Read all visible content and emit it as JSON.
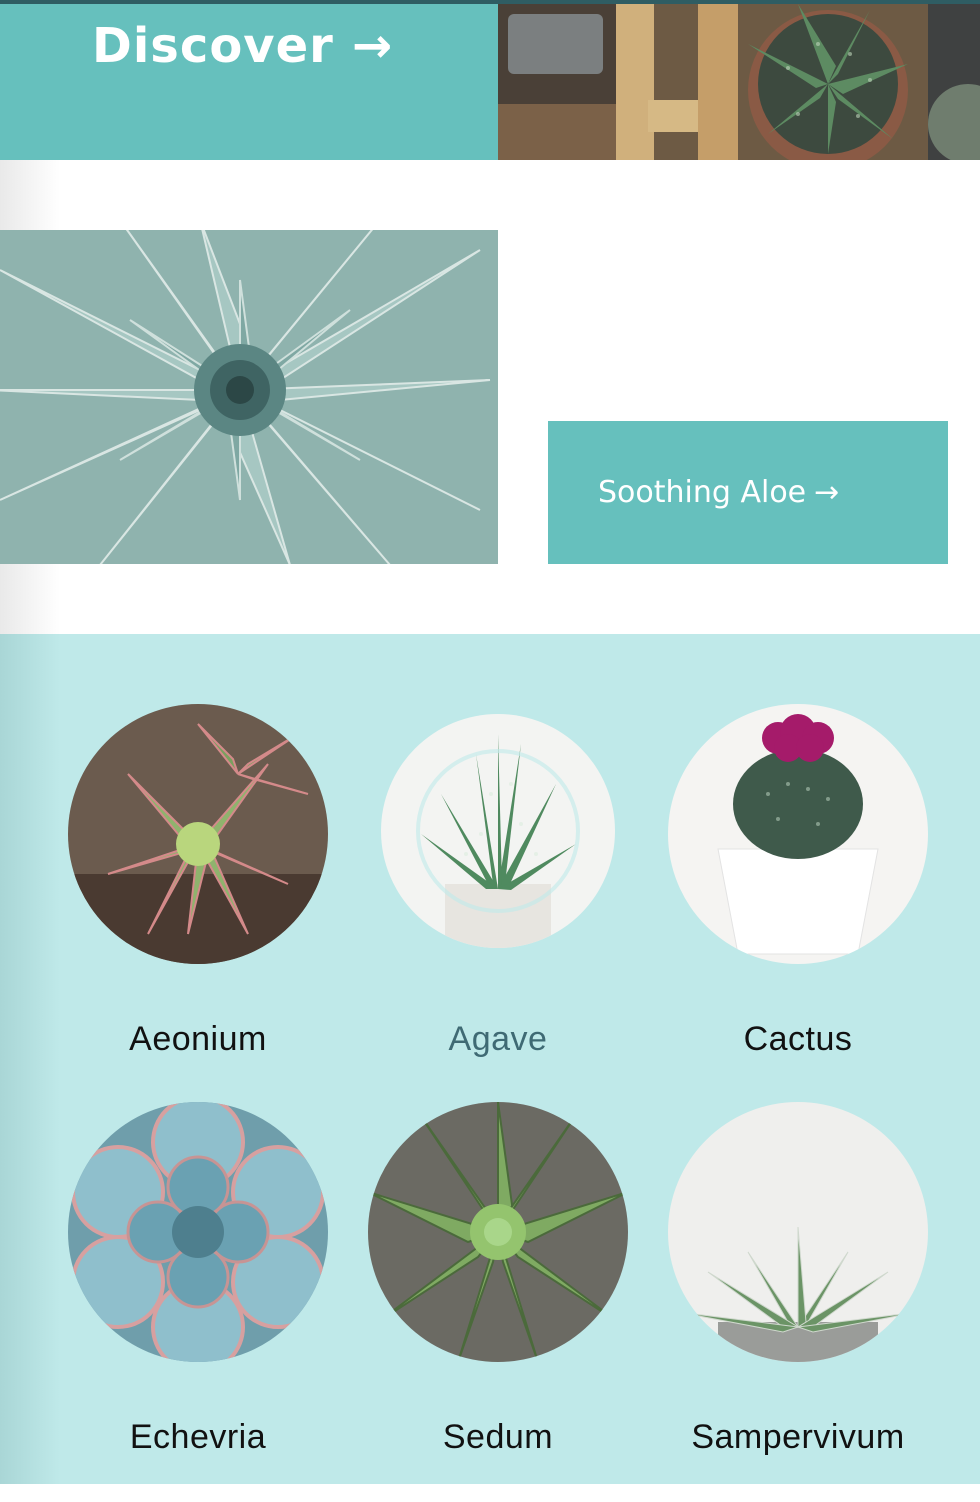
{
  "hero": {
    "discover_label": "Discover",
    "discover_arrow": "→",
    "image_alt": "succulents in pots in a wooden crate",
    "tile_color": "#66c0bd"
  },
  "feature": {
    "image_alt": "agave rosette close-up",
    "cta_label": "Soothing Aloe",
    "cta_arrow": "→"
  },
  "catalog": {
    "background": "#bfe9e9",
    "items": [
      {
        "label": "Aeonium"
      },
      {
        "label": "Agave"
      },
      {
        "label": "Cactus"
      },
      {
        "label": "Echevria"
      },
      {
        "label": "Sedum"
      },
      {
        "label": "Sampervivum"
      }
    ]
  }
}
